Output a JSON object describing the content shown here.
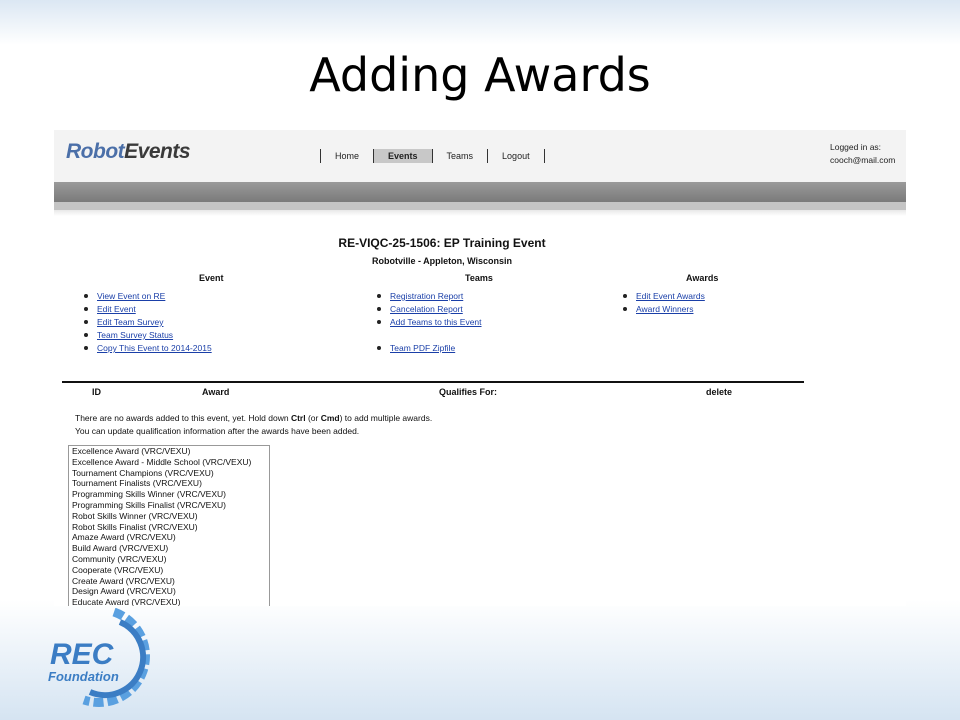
{
  "slide": {
    "title": "Adding Awards"
  },
  "header": {
    "logo_part1": "Robot",
    "logo_part2": "Events",
    "nav": [
      "Home",
      "Events",
      "Teams",
      "Logout"
    ],
    "login_label": "Logged in as:",
    "login_user": "cooch@mail.com"
  },
  "event": {
    "title": "RE-VIQC-25-1506: EP Training Event",
    "location": "Robotville - Appleton, Wisconsin"
  },
  "columns": {
    "event": {
      "heading": "Event",
      "links": [
        "View Event on RE",
        "Edit Event",
        "Edit Team Survey",
        "Team Survey Status",
        "Copy This Event to 2014-2015"
      ]
    },
    "teams": {
      "heading": "Teams",
      "links": [
        "Registration Report",
        "Cancelation Report",
        "Add Teams to this Event",
        "Team PDF Zipfile"
      ]
    },
    "awards": {
      "heading": "Awards",
      "links": [
        "Edit Event Awards",
        "Award Winners"
      ]
    }
  },
  "table": {
    "headers": {
      "id": "ID",
      "award": "Award",
      "qualifies": "Qualifies For:",
      "delete": "delete"
    },
    "info_line1_a": "There are no awards added to this event, yet. Hold down ",
    "info_key1": "Ctrl",
    "info_line1_b": " (or ",
    "info_key2": "Cmd",
    "info_line1_c": ") to add multiple awards.",
    "info_line2": "You can update qualification information after the awards have been added."
  },
  "award_options": [
    "Excellence Award (VRC/VEXU)",
    "Excellence Award - Middle School (VRC/VEXU)",
    "Tournament Champions (VRC/VEXU)",
    "Tournament Finalists (VRC/VEXU)",
    "Programming Skills Winner (VRC/VEXU)",
    "Programming Skills Finalist (VRC/VEXU)",
    "Robot Skills Winner (VRC/VEXU)",
    "Robot Skills Finalist (VRC/VEXU)",
    "Amaze Award (VRC/VEXU)",
    "Build Award (VRC/VEXU)",
    "Community (VRC/VEXU)",
    "Cooperate (VRC/VEXU)",
    "Create Award (VRC/VEXU)",
    "Design Award (VRC/VEXU)",
    "Educate Award (VRC/VEXU)"
  ],
  "footer": {
    "logo_top": "REC",
    "logo_bottom": "Foundation"
  },
  "colors": {
    "link": "#1a3fa8",
    "logo_blue": "#3b7dc4",
    "logo_blue_light": "#5aa0e0"
  }
}
